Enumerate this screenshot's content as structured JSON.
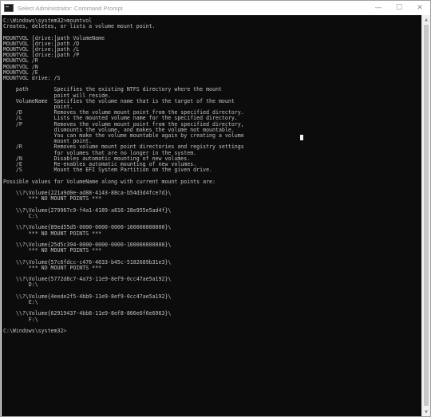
{
  "window": {
    "title": "Select Administrator: Command Prompt",
    "controls": {
      "minimize": "—",
      "maximize": "☐",
      "close": "✕"
    }
  },
  "console": {
    "output": "C:\\Windows\\system32>mountvol\nCreates, deletes, or lists a volume mount point.\n\nMOUNTVOL [drive:]path VolumeName\nMOUNTVOL [drive:]path /D\nMOUNTVOL [drive:]path /L\nMOUNTVOL [drive:]path /P\nMOUNTVOL /R\nMOUNTVOL /N\nMOUNTVOL /E\nMOUNTVOL drive: /S\n\n    path        Specifies the existing NTFS directory where the mount\n                point will reside.\n    VolumeName  Specifies the volume name that is the target of the mount\n                point.\n    /D          Removes the volume mount point from the specified directory.\n    /L          Lists the mounted volume name for the specified directory.\n    /P          Removes the volume mount point from the specified directory,\n                dismounts the volume, and makes the volume not mountable.\n                You can make the volume mountable again by creating a volume\n                mount point.\n    /R          Removes volume mount point directories and registry settings\n                for volumes that are no longer in the system.\n    /N          Disables automatic mounting of new volumes.\n    /E          Re-enables automatic mounting of new volumes.\n    /S          Mount the EFI System Partition on the given drive.\n\nPossible values for VolumeName along with current mount points are:\n\n    \\\\?\\Volume{221a9d0e-ad88-4143-88ca-b54d3d4fce7d}\\\n        *** NO MOUNT POINTS ***\n\n    \\\\?\\Volume{279967c9-f4a1-4189-a816-28e955e5ad4f}\\\n        C:\\\n\n    \\\\?\\Volume{89ed55d5-0000-0000-0000-100000000000}\\\n        *** NO MOUNT POINTS ***\n\n    \\\\?\\Volume{25d5c394-0000-0000-0000-100000000000}\\\n        *** NO MOUNT POINTS ***\n\n    \\\\?\\Volume{57c6fdcc-c476-4033-b45c-5182689b31e3}\\\n        *** NO MOUNT POINTS ***\n\n    \\\\?\\Volume{5772d8c7-4a73-11e9-8ef9-0cc47ae5a192}\\\n        D:\\\n\n    \\\\?\\Volume{4eede2f5-4bb9-11e9-8ef9-0cc47ae5a192}\\\n        E:\\\n\n    \\\\?\\Volume{62919437-4bb8-11e9-8ef8-806e6f6e6963}\\\n        F:\\\n\nC:\\Windows\\system32>"
  },
  "colors": {
    "console_background": "#0c0c0c",
    "console_text": "#c0c0c0",
    "titlebar_background": "#ffffff",
    "title_text": "#9a9a9a"
  },
  "icons": {
    "app": "command-prompt-icon",
    "scroll_up": "▲",
    "scroll_down": "▼"
  }
}
